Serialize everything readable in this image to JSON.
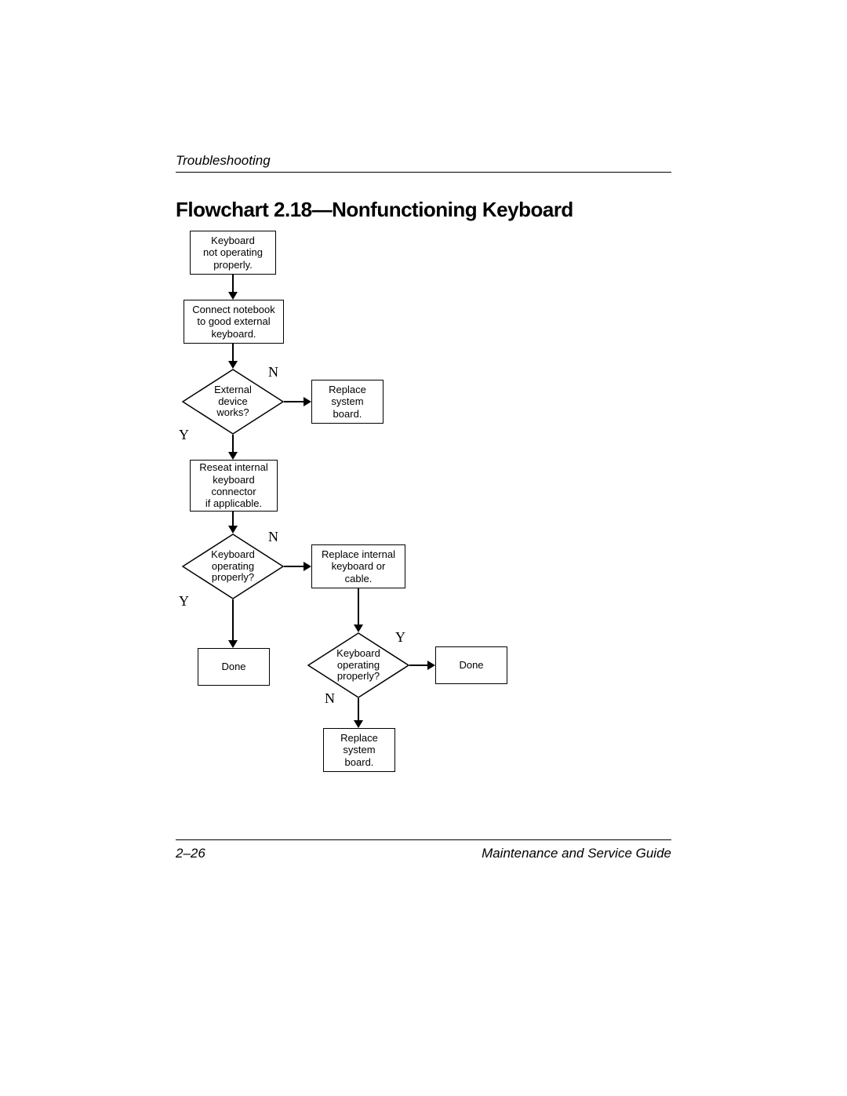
{
  "header": {
    "section": "Troubleshooting"
  },
  "title": "Flowchart 2.18—Nonfunctioning Keyboard",
  "nodes": {
    "start": "Keyboard\nnot operating\nproperly.",
    "connect": "Connect notebook\nto good external\nkeyboard.",
    "extworks": "External\ndevice\nworks?",
    "replace_sb1": "Replace\nsystem\nboard.",
    "reseat": "Reseat internal\nkeyboard\nconnector\nif applicable.",
    "kb_op1": "Keyboard\noperating\nproperly?",
    "replace_kb": "Replace internal\nkeyboard or\ncable.",
    "done1": "Done",
    "kb_op2": "Keyboard\noperating\nproperly?",
    "done2": "Done",
    "replace_sb2": "Replace\nsystem\nboard."
  },
  "labels": {
    "yes": "Y",
    "no": "N"
  },
  "footer": {
    "page": "2–26",
    "book": "Maintenance and Service Guide"
  }
}
